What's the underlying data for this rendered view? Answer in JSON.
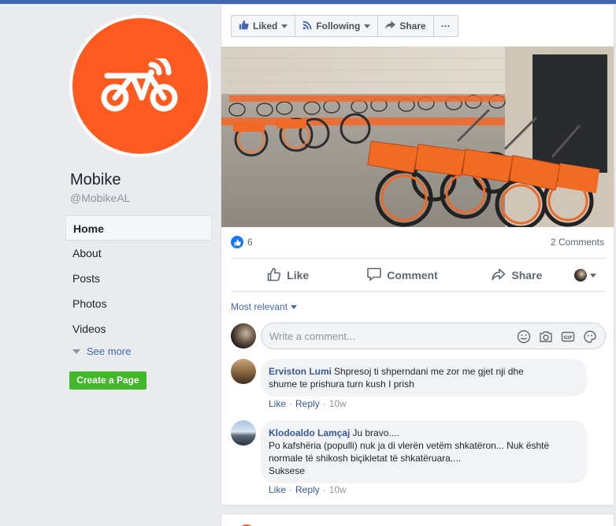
{
  "page": {
    "name": "Mobike",
    "handle": "@MobikeAL",
    "brand_color": "#ff5a1f",
    "avatar_icon": "bike-wifi-icon"
  },
  "nav": {
    "items": [
      "Home",
      "About",
      "Posts",
      "Photos",
      "Videos"
    ],
    "active": "Home",
    "see_more": "See more"
  },
  "create_page": "Create a Page",
  "post_actions": {
    "liked": "Liked",
    "following": "Following",
    "share": "Share",
    "more": "···"
  },
  "post": {
    "photo_alt_icon": "bike-fleet-photo",
    "reaction_count": "6",
    "comments_count": "2 Comments",
    "like_label": "Like",
    "comment_label": "Comment",
    "share_label": "Share"
  },
  "comments_section": {
    "sort_label": "Most relevant",
    "placeholder": "Write a comment..."
  },
  "comments": [
    {
      "author": "Erviston Lumi",
      "text_line1": "Shpresoj ti shperndani me zor me gjet nji dhe",
      "text_line2": "shume te prishura turn kush I prish",
      "like": "Like",
      "reply": "Reply",
      "time": "10w"
    },
    {
      "author": "Klodoaldo Lamçaj",
      "text_line1": "Ju bravo....",
      "text_line2": "Po kafshëria (populli) nuk ja di vlerën vetëm shkatëron... Nuk është",
      "text_line3": "normale të shikosh biçikletat të shkatëruara....",
      "text_line4": "Suksese",
      "like": "Like",
      "reply": "Reply",
      "time": "10w"
    }
  ]
}
